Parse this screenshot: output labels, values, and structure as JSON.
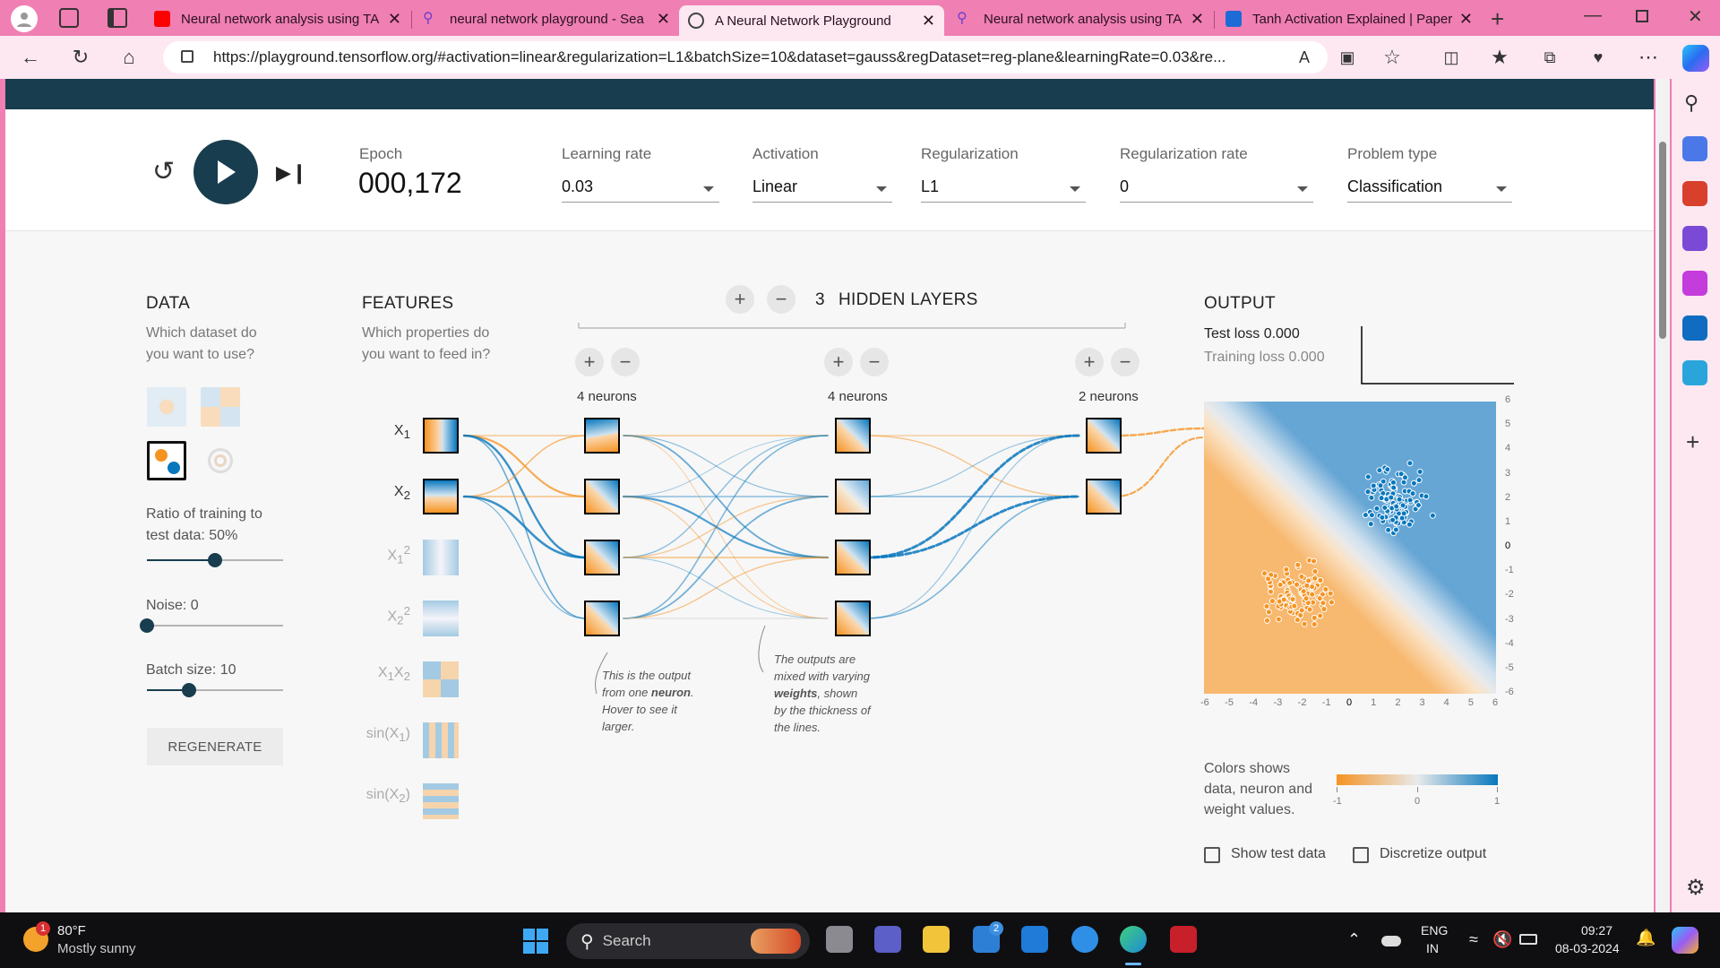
{
  "browser": {
    "tabs": [
      {
        "title": "Neural network analysis using TA",
        "active": false
      },
      {
        "title": "neural network playground - Sea",
        "active": false
      },
      {
        "title": "A Neural Network Playground",
        "active": true
      },
      {
        "title": "Neural network analysis using TA",
        "active": false
      },
      {
        "title": "Tanh Activation Explained | Paper",
        "active": false
      }
    ],
    "url": "https://playground.tensorflow.org/#activation=linear&regularization=L1&batchSize=10&dataset=gauss&regDataset=reg-plane&learningRate=0.03&re..."
  },
  "controls": {
    "epoch_label": "Epoch",
    "epoch_value": "000,172",
    "learning_rate_label": "Learning rate",
    "learning_rate_value": "0.03",
    "activation_label": "Activation",
    "activation_value": "Linear",
    "regularization_label": "Regularization",
    "regularization_value": "L1",
    "reg_rate_label": "Regularization rate",
    "reg_rate_value": "0",
    "problem_type_label": "Problem type",
    "problem_type_value": "Classification"
  },
  "data_panel": {
    "title": "DATA",
    "subtitle_1": "Which dataset do",
    "subtitle_2": "you want to use?",
    "ratio_label_1": "Ratio of training to",
    "ratio_label_2": "test data:  50%",
    "ratio_value": 0.5,
    "noise_label": "Noise:  0",
    "noise_value": 0,
    "batch_label": "Batch size:  10",
    "batch_value": 10,
    "regenerate": "REGENERATE"
  },
  "features_panel": {
    "title": "FEATURES",
    "subtitle_1": "Which properties do",
    "subtitle_2": "you want to feed in?",
    "features": [
      "X1",
      "X2",
      "X1²",
      "X2²",
      "X1X2",
      "sin(X1)",
      "sin(X2)"
    ]
  },
  "network": {
    "hidden_layers_count": "3",
    "hidden_layers_label": "HIDDEN LAYERS",
    "layers": [
      {
        "label": "4 neurons"
      },
      {
        "label": "4 neurons"
      },
      {
        "label": "2 neurons"
      }
    ],
    "note1": [
      "This is the output",
      "from one ",
      "neuron",
      ".",
      "Hover to see it",
      "larger."
    ],
    "note2": [
      "The outputs are",
      "mixed with varying",
      "weights",
      ", shown",
      "by the thickness of",
      "the lines."
    ]
  },
  "output_panel": {
    "title": "OUTPUT",
    "test_loss": "Test loss 0.000",
    "training_loss": "Training loss 0.000",
    "y_ticks": [
      "6",
      "5",
      "4",
      "3",
      "2",
      "1",
      "0",
      "-1",
      "-2",
      "-3",
      "-4",
      "-5",
      "-6"
    ],
    "x_ticks": [
      "-6",
      "-5",
      "-4",
      "-3",
      "-2",
      "-1",
      "0",
      "1",
      "2",
      "3",
      "4",
      "5",
      "6"
    ],
    "legend_text_1": "Colors shows",
    "legend_text_2": "data, neuron and",
    "legend_text_3": "weight values.",
    "legend_min": "-1",
    "legend_mid": "0",
    "legend_max": "1",
    "show_test_data": "Show test data",
    "discretize_output": "Discretize output",
    "colors": {
      "orange": "#f59322",
      "blue": "#0877bd",
      "light": "#e8eaeb"
    }
  },
  "taskbar": {
    "weather_temp": "80°F",
    "weather_desc": "Mostly sunny",
    "weather_badge": "1",
    "search_placeholder": "Search",
    "store_badge": "2",
    "lang_1": "ENG",
    "lang_2": "IN",
    "time": "09:27",
    "date": "08-03-2024"
  }
}
